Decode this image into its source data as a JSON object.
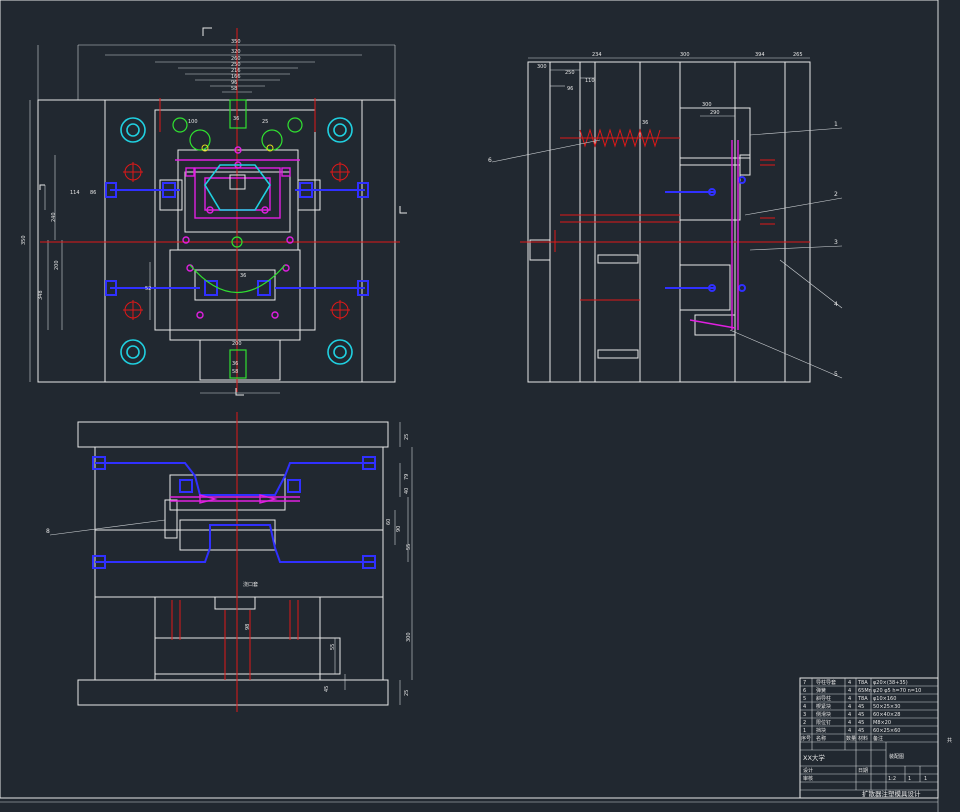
{
  "drawing": {
    "top_view": {
      "dims": {
        "overall_width": "350",
        "d1": "320",
        "d2": "260",
        "d3": "250",
        "d4": "216",
        "d5": "166",
        "d6": "96",
        "d7": "58",
        "d8": "36",
        "left_a": "86",
        "left_b": "114",
        "left_c": "348",
        "left_d": "350",
        "left_e": "200",
        "left_f": "240",
        "mid_a": "36",
        "bot_a": "200",
        "bot_b": "52",
        "bot_c": "270",
        "top_c": "100",
        "top_d": "25",
        "top_e": "58"
      }
    },
    "side_view": {
      "dims": {
        "a": "234",
        "b": "300",
        "c": "394",
        "d": "265",
        "e": "300",
        "f": "250",
        "g": "110",
        "h": "96",
        "i": "300",
        "j": "290",
        "k": "36"
      },
      "balloons": [
        "1",
        "2",
        "3",
        "4",
        "5",
        "6"
      ]
    },
    "section_view": {
      "dims": {
        "a": "25",
        "b": "79",
        "c": "40",
        "d": "60",
        "e": "90",
        "f": "55",
        "g": "300",
        "h": "98",
        "i": "25",
        "j": "55",
        "k": "90",
        "l": "45"
      },
      "balloon": "8",
      "label": "浇口套"
    }
  },
  "title_block": {
    "parts": [
      {
        "no": "7",
        "name": "导柱导套",
        "qty": "4",
        "material": "T8A",
        "note": "φ20×(38+35)"
      },
      {
        "no": "6",
        "name": "弹簧",
        "qty": "4",
        "material": "65Mn",
        "note": "φ20 φ5 h=70 n=10"
      },
      {
        "no": "5",
        "name": "斜导柱",
        "qty": "4",
        "material": "T8A",
        "note": "φ10×160"
      },
      {
        "no": "4",
        "name": "楔紧块",
        "qty": "4",
        "material": "45",
        "note": "50×25×30"
      },
      {
        "no": "3",
        "name": "侧滑块",
        "qty": "4",
        "material": "45",
        "note": "60×40×28"
      },
      {
        "no": "2",
        "name": "限位钉",
        "qty": "4",
        "material": "45",
        "note": "M8×20"
      },
      {
        "no": "1",
        "name": "挡块",
        "qty": "4",
        "material": "45",
        "note": "60×25×60"
      }
    ],
    "header": [
      "序号",
      "名称",
      "数量",
      "材料",
      "备注"
    ],
    "school": "XX大学",
    "drawing_title": "扩散器注塑模具设计",
    "sub": "装配图",
    "ratio": "1:2",
    "sheet": "1",
    "sheets": "1",
    "designer": "设计",
    "checker": "审核",
    "date": "日期"
  },
  "right_mark": "共"
}
